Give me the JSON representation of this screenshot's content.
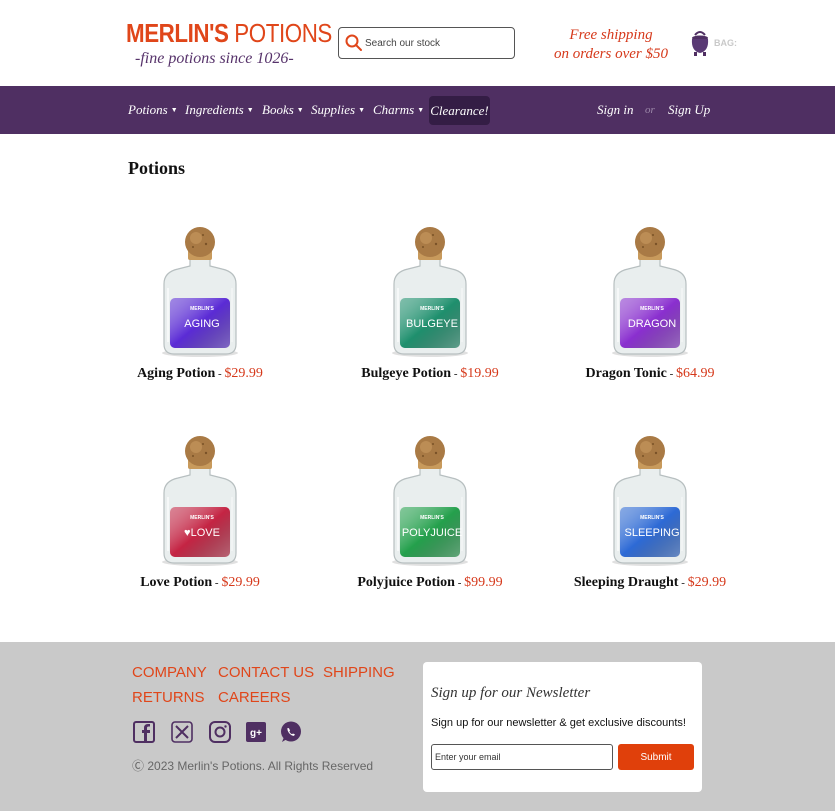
{
  "brand": {
    "title_bold": "MERLIN'S",
    "title_rest": " POTIONS",
    "tagline": "-fine potions since 1026-"
  },
  "search": {
    "placeholder": "Search our stock"
  },
  "shipping": {
    "line1": "Free shipping",
    "line2": "on orders over $50"
  },
  "bag": {
    "label": "BAG:"
  },
  "nav": {
    "items": [
      {
        "label": "Potions"
      },
      {
        "label": "Ingredients"
      },
      {
        "label": "Books"
      },
      {
        "label": "Supplies"
      },
      {
        "label": "Charms"
      }
    ],
    "clearance": "Clearance!",
    "sign_in": "Sign in",
    "or": "or",
    "sign_up": "Sign Up"
  },
  "main": {
    "title": "Potions",
    "products": [
      {
        "name": "Aging Potion",
        "sep": " - ",
        "price": "$29.99",
        "label": "AGING",
        "color": "#5b2bd6"
      },
      {
        "name": "Bulgeye Potion",
        "sep": " - ",
        "price": "$19.99",
        "label": "BULGEYE",
        "color": "#1f8f6e"
      },
      {
        "name": "Dragon Tonic",
        "sep": " - ",
        "price": "$64.99",
        "label": "DRAGON",
        "color": "#8a2fcf"
      },
      {
        "name": "Love Potion",
        "sep": " - ",
        "price": "$29.99",
        "label": "♥LOVE",
        "color": "#c42444"
      },
      {
        "name": "Polyjuice Potion",
        "sep": " - ",
        "price": "$99.99",
        "label": "POLYJUICE",
        "color": "#24a04c"
      },
      {
        "name": "Sleeping Draught",
        "sep": " - ",
        "price": "$29.99",
        "label": "SLEEPING",
        "color": "#2d6ad6"
      }
    ],
    "bottle_brand": "MERLIN'S"
  },
  "footer": {
    "links": [
      "COMPANY",
      "CONTACT US",
      "SHIPPING",
      "RETURNS",
      "CAREERS"
    ],
    "social": [
      "facebook-icon",
      "x-icon",
      "instagram-icon",
      "google-plus-icon",
      "whatsapp-icon"
    ],
    "copyright": "2023 Merlin's Potions. All Rights Reserved"
  },
  "newsletter": {
    "title": "Sign up for our Newsletter",
    "text": "Sign up for our newsletter & get exclusive discounts!",
    "placeholder": "Enter your email",
    "submit": "Submit"
  },
  "colors": {
    "accent": "#e0461a",
    "nav": "#4f2f62",
    "footer": "#c9c9c9"
  }
}
